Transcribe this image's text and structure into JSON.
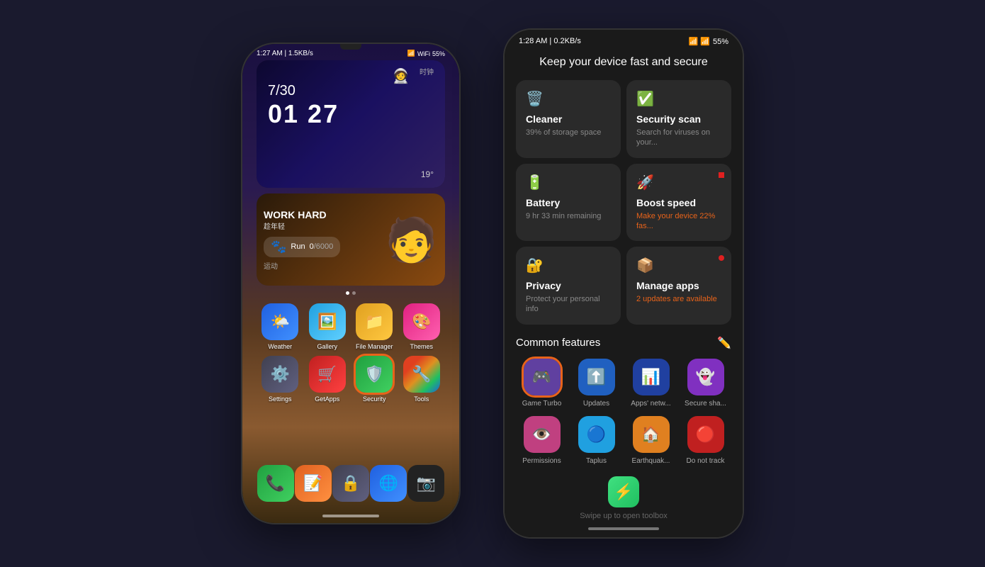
{
  "left_phone": {
    "status_bar": {
      "time": "1:27 AM | 1.5KB/s",
      "battery": "55%",
      "icons": "📶 📶 🔋"
    },
    "clock": {
      "date": "7/30",
      "time": "01 27",
      "temp": "19°",
      "label": "时钟"
    },
    "character": {
      "text": "WORK HARD",
      "sub": "趁年轻"
    },
    "run": {
      "label": "Run",
      "count": "0",
      "total": "/6000",
      "section": "运动"
    },
    "apps_row1": [
      {
        "name": "Weather",
        "emoji": "🌤️",
        "bg": "bg-blue"
      },
      {
        "name": "Gallery",
        "emoji": "🖼️",
        "bg": "bg-lightblue"
      },
      {
        "name": "File Manager",
        "emoji": "📁",
        "bg": "bg-yellow"
      },
      {
        "name": "Themes",
        "emoji": "🎨",
        "bg": "bg-pink"
      }
    ],
    "apps_row2": [
      {
        "name": "Settings",
        "emoji": "⚙️",
        "bg": "bg-gray"
      },
      {
        "name": "GetApps",
        "emoji": "🛒",
        "bg": "bg-red"
      },
      {
        "name": "Security",
        "emoji": "🛡️",
        "bg": "bg-green",
        "highlighted": true
      },
      {
        "name": "Tools",
        "emoji": "🔧",
        "bg": "bg-multi"
      }
    ],
    "dock": [
      {
        "name": "Phone",
        "emoji": "📞",
        "bg": "bg-green"
      },
      {
        "name": "Notes",
        "emoji": "📝",
        "bg": "bg-orange"
      },
      {
        "name": "Lock",
        "emoji": "🔒",
        "bg": "bg-gray"
      },
      {
        "name": "Chrome",
        "emoji": "🌐",
        "bg": "bg-blue"
      },
      {
        "name": "Camera",
        "emoji": "📷",
        "bg": "bg-darkgray"
      }
    ]
  },
  "right_phone": {
    "status_bar": {
      "time": "1:28 AM | 0.2KB/s",
      "battery": "55%"
    },
    "title": "Keep your device fast and secure",
    "feature_cards": [
      {
        "id": "cleaner",
        "icon": "🗑️",
        "icon_color": "#E8631A",
        "title": "Cleaner",
        "subtitle": "39% of storage space",
        "subtitle_color": "normal"
      },
      {
        "id": "security_scan",
        "icon": "✅",
        "icon_color": "#20c060",
        "title": "Security scan",
        "subtitle": "Search for viruses on your...",
        "subtitle_color": "normal"
      },
      {
        "id": "battery",
        "icon": "🔋",
        "icon_color": "#20a040",
        "title": "Battery",
        "subtitle": "9 hr 33 min  remaining",
        "subtitle_color": "normal"
      },
      {
        "id": "boost_speed",
        "icon": "🚀",
        "icon_color": "#2060e0",
        "title": "Boost speed",
        "subtitle": "Make your device 22% fas...",
        "subtitle_color": "orange"
      },
      {
        "id": "privacy",
        "icon": "🔐",
        "icon_color": "#2080e0",
        "title": "Privacy",
        "subtitle": "Protect your personal info",
        "subtitle_color": "normal"
      },
      {
        "id": "manage_apps",
        "icon": "📦",
        "icon_color": "#E8631A",
        "title": "Manage apps",
        "subtitle": "2 updates are available",
        "subtitle_color": "orange"
      }
    ],
    "common_features": {
      "title": "Common features",
      "edit_icon": "✏️",
      "items": [
        {
          "id": "game_turbo",
          "emoji": "🎮",
          "label": "Game Turbo",
          "bg": "#6040a0",
          "highlighted": true
        },
        {
          "id": "updates",
          "emoji": "⬆️",
          "label": "Updates",
          "bg": "#2060c0"
        },
        {
          "id": "apps_network",
          "emoji": "📊",
          "label": "Apps' netw...",
          "bg": "#2040a0"
        },
        {
          "id": "secure_share",
          "emoji": "👻",
          "label": "Secure sha...",
          "bg": "#8030c0"
        },
        {
          "id": "permissions",
          "emoji": "👁️",
          "label": "Permissions",
          "bg": "#c04080"
        },
        {
          "id": "taplus",
          "emoji": "🔵",
          "label": "Taplus",
          "bg": "#20a0e0"
        },
        {
          "id": "earthquake",
          "emoji": "🏠",
          "label": "Earthquak...",
          "bg": "#e08020"
        },
        {
          "id": "do_not_track",
          "emoji": "🔴",
          "label": "Do not track",
          "bg": "#c02020"
        }
      ]
    },
    "toolbox": {
      "label": "Swipe up to open toolbox",
      "icon": "⚡"
    }
  }
}
